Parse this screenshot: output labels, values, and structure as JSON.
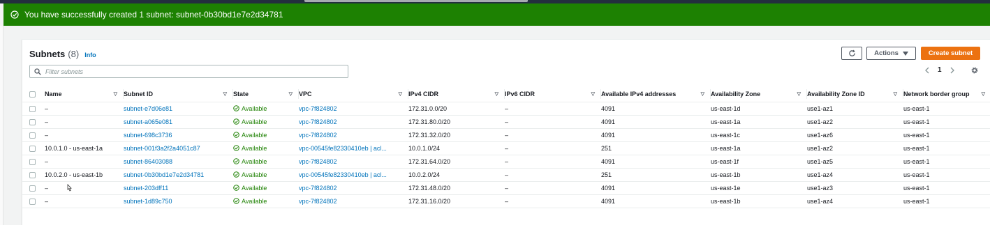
{
  "flash": {
    "message": "You have successfully created 1 subnet: subnet-0b30bd1e7e2d34781"
  },
  "header": {
    "title": "Subnets",
    "count": "(8)",
    "info": "Info"
  },
  "toolbar": {
    "actions_label": "Actions",
    "create_label": "Create subnet"
  },
  "search": {
    "placeholder": "Filter subnets"
  },
  "pager": {
    "page": "1"
  },
  "columns": [
    "Name",
    "Subnet ID",
    "State",
    "VPC",
    "IPv4 CIDR",
    "IPv6 CIDR",
    "Available IPv4 addresses",
    "Availability Zone",
    "Availability Zone ID",
    "Network border group"
  ],
  "rows": [
    {
      "name": "–",
      "subnet_id": "subnet-e7d06e81",
      "state": "Available",
      "vpc": "vpc-7f824802",
      "ipv4": "172.31.0.0/20",
      "ipv6": "–",
      "avail_ips": "4091",
      "az": "us-east-1d",
      "az_id": "use1-az1",
      "nbg": "us-east-1"
    },
    {
      "name": "–",
      "subnet_id": "subnet-a065e081",
      "state": "Available",
      "vpc": "vpc-7f824802",
      "ipv4": "172.31.80.0/20",
      "ipv6": "–",
      "avail_ips": "4091",
      "az": "us-east-1a",
      "az_id": "use1-az2",
      "nbg": "us-east-1"
    },
    {
      "name": "–",
      "subnet_id": "subnet-698c3736",
      "state": "Available",
      "vpc": "vpc-7f824802",
      "ipv4": "172.31.32.0/20",
      "ipv6": "–",
      "avail_ips": "4091",
      "az": "us-east-1c",
      "az_id": "use1-az6",
      "nbg": "us-east-1"
    },
    {
      "name": "10.0.1.0 - us-east-1a",
      "subnet_id": "subnet-001f3a2f2a4051c87",
      "state": "Available",
      "vpc": "vpc-00545fe82330410eb | acl...",
      "ipv4": "10.0.1.0/24",
      "ipv6": "–",
      "avail_ips": "251",
      "az": "us-east-1a",
      "az_id": "use1-az2",
      "nbg": "us-east-1"
    },
    {
      "name": "–",
      "subnet_id": "subnet-86403088",
      "state": "Available",
      "vpc": "vpc-7f824802",
      "ipv4": "172.31.64.0/20",
      "ipv6": "–",
      "avail_ips": "4091",
      "az": "us-east-1f",
      "az_id": "use1-az5",
      "nbg": "us-east-1"
    },
    {
      "name": "10.0.2.0 - us-east-1b",
      "subnet_id": "subnet-0b30bd1e7e2d34781",
      "state": "Available",
      "vpc": "vpc-00545fe82330410eb | acl...",
      "ipv4": "10.0.2.0/24",
      "ipv6": "–",
      "avail_ips": "251",
      "az": "us-east-1b",
      "az_id": "use1-az4",
      "nbg": "us-east-1"
    },
    {
      "name": "–",
      "subnet_id": "subnet-203dff11",
      "state": "Available",
      "vpc": "vpc-7f824802",
      "ipv4": "172.31.48.0/20",
      "ipv6": "–",
      "avail_ips": "4091",
      "az": "us-east-1e",
      "az_id": "use1-az3",
      "nbg": "us-east-1"
    },
    {
      "name": "–",
      "subnet_id": "subnet-1d89c750",
      "state": "Available",
      "vpc": "vpc-7f824802",
      "ipv4": "172.31.16.0/20",
      "ipv6": "–",
      "avail_ips": "4091",
      "az": "us-east-1b",
      "az_id": "use1-az4",
      "nbg": "us-east-1"
    }
  ],
  "colors": {
    "success": "#1d8102",
    "link": "#0073bb",
    "primary": "#ec7211"
  },
  "icons": [
    "success-check-icon",
    "refresh-icon",
    "caret-down-icon",
    "search-icon",
    "chevron-left-icon",
    "chevron-right-icon",
    "gear-icon",
    "sort-icon",
    "status-ok-icon"
  ]
}
